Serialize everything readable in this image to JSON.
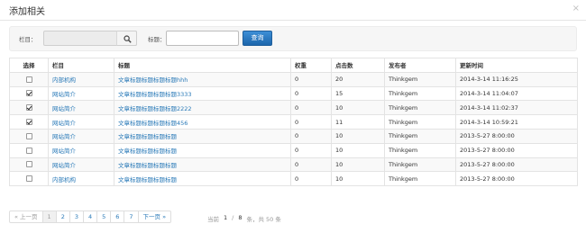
{
  "dialog": {
    "title": "添加相关",
    "close_glyph": "×"
  },
  "search": {
    "column_label": "栏目：",
    "column_value": "",
    "title_label": "标题：",
    "title_value": "",
    "query_label": "查询"
  },
  "table": {
    "headers": [
      "选择",
      "栏目",
      "标题",
      "权重",
      "点击数",
      "发布者",
      "更新时间"
    ],
    "rows": [
      {
        "checked": false,
        "column": "内部机构",
        "title": "文章标题标题标题标题hhh",
        "weight": "0",
        "clicks": "20",
        "publisher": "Thinkgem",
        "updated": "2014-3-14 11:16:25"
      },
      {
        "checked": true,
        "column": "网站简介",
        "title": "文章标题标题标题标题3333",
        "weight": "0",
        "clicks": "15",
        "publisher": "Thinkgem",
        "updated": "2014-3-14 11:04:07"
      },
      {
        "checked": true,
        "column": "网站简介",
        "title": "文章标题标题标题标题2222",
        "weight": "0",
        "clicks": "10",
        "publisher": "Thinkgem",
        "updated": "2014-3-14 11:02:37"
      },
      {
        "checked": true,
        "column": "网站简介",
        "title": "文章标题标题标题标题456",
        "weight": "0",
        "clicks": "11",
        "publisher": "Thinkgem",
        "updated": "2014-3-14 10:59:21"
      },
      {
        "checked": false,
        "column": "网站简介",
        "title": "文章标题标题标题标题",
        "weight": "0",
        "clicks": "10",
        "publisher": "Thinkgem",
        "updated": "2013-5-27 8:00:00"
      },
      {
        "checked": false,
        "column": "网站简介",
        "title": "文章标题标题标题标题",
        "weight": "0",
        "clicks": "10",
        "publisher": "Thinkgem",
        "updated": "2013-5-27 8:00:00"
      },
      {
        "checked": false,
        "column": "网站简介",
        "title": "文章标题标题标题标题",
        "weight": "0",
        "clicks": "10",
        "publisher": "Thinkgem",
        "updated": "2013-5-27 8:00:00"
      },
      {
        "checked": false,
        "column": "内部机构",
        "title": "文章标题标题标题标题",
        "weight": "0",
        "clicks": "10",
        "publisher": "Thinkgem",
        "updated": "2013-5-27 8:00:00"
      }
    ]
  },
  "pagination": {
    "prev_label": "« 上一页",
    "pages": [
      "1",
      "2",
      "3",
      "4",
      "5",
      "6",
      "7"
    ],
    "current_page": "1",
    "next_label": "下一页 »",
    "info_current_label": "当前",
    "info_current": "1",
    "info_sep": "/",
    "info_total_pages": "8",
    "info_suffix": "条，共 50 条"
  },
  "colors": {
    "link": "#2a7ab8",
    "primary_button": "#1d66ac",
    "stripe": "#f9f9f9"
  }
}
